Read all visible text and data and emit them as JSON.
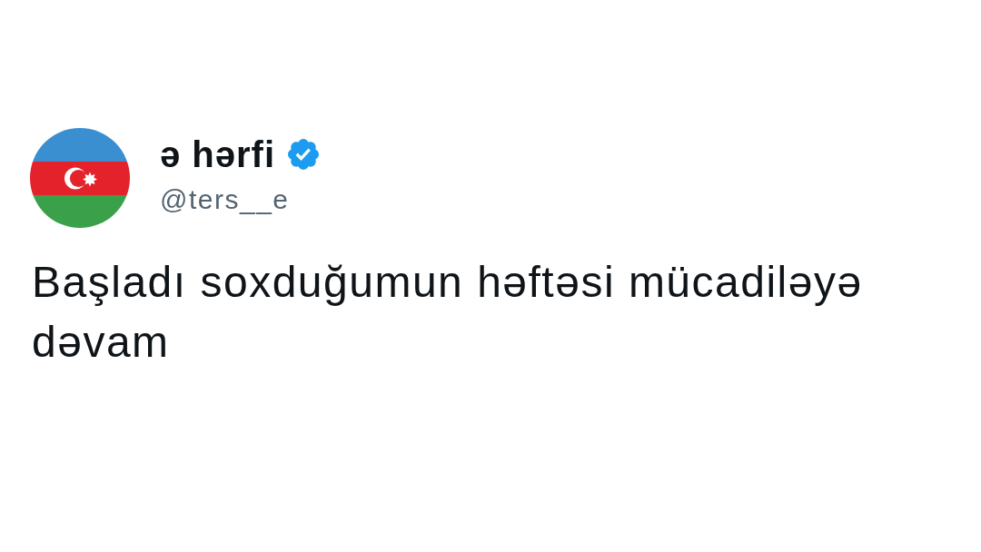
{
  "tweet": {
    "author": {
      "name": "ə hərfi",
      "verified": true,
      "handle": "@ters__e"
    },
    "text": "Başladı soxduğumun həftəsi mücadiləyə dəvam"
  }
}
